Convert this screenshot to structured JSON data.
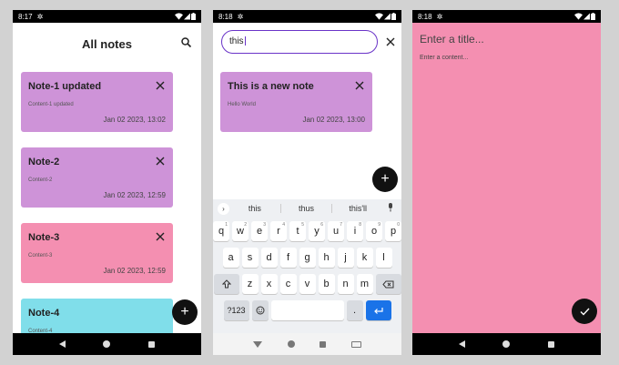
{
  "screen1": {
    "status_time": "8:17",
    "title": "All notes",
    "notes": [
      {
        "title": "Note-1 updated",
        "content": "Content-1 updated",
        "date": "Jan 02 2023, 13:02",
        "color": "#ce93d8"
      },
      {
        "title": "Note-2",
        "content": "Content-2",
        "date": "Jan 02 2023, 12:59",
        "color": "#ce93d8"
      },
      {
        "title": "Note-3",
        "content": "Content-3",
        "date": "Jan 02 2023, 12:59",
        "color": "#f48fb1"
      },
      {
        "title": "Note-4",
        "content": "Content-4",
        "date": "",
        "color": "#80deea"
      }
    ],
    "fab_label": "+"
  },
  "screen2": {
    "status_time": "8:18",
    "search_value": "this",
    "result": {
      "title": "This is a new note",
      "content": "Hello World",
      "date": "Jan 02 2023, 13:00",
      "color": "#ce93d8"
    },
    "fab_label": "+",
    "suggestions": [
      "this",
      "thus",
      "this'll"
    ],
    "rows": [
      [
        [
          "q",
          "1"
        ],
        [
          "w",
          "2"
        ],
        [
          "e",
          "3"
        ],
        [
          "r",
          "4"
        ],
        [
          "t",
          "5"
        ],
        [
          "y",
          "6"
        ],
        [
          "u",
          "7"
        ],
        [
          "i",
          "8"
        ],
        [
          "o",
          "9"
        ],
        [
          "p",
          "0"
        ]
      ],
      [
        [
          "a",
          ""
        ],
        [
          "s",
          ""
        ],
        [
          "d",
          ""
        ],
        [
          "f",
          ""
        ],
        [
          "g",
          ""
        ],
        [
          "h",
          ""
        ],
        [
          "j",
          ""
        ],
        [
          "k",
          ""
        ],
        [
          "l",
          ""
        ]
      ],
      [
        [
          "z",
          ""
        ],
        [
          "x",
          ""
        ],
        [
          "c",
          ""
        ],
        [
          "v",
          ""
        ],
        [
          "b",
          ""
        ],
        [
          "n",
          ""
        ],
        [
          "m",
          ""
        ]
      ]
    ],
    "key_symbols": "?123",
    "key_period": "."
  },
  "screen3": {
    "status_time": "8:18",
    "title_placeholder": "Enter a title...",
    "content_placeholder": "Enter a content...",
    "bg_color": "#f48fb1"
  },
  "icons": {
    "search": "search-icon",
    "close": "close-icon",
    "check": "check-icon",
    "settings": "gear-icon",
    "wifi": "wifi-icon",
    "signal": "signal-icon",
    "battery": "battery-icon"
  }
}
